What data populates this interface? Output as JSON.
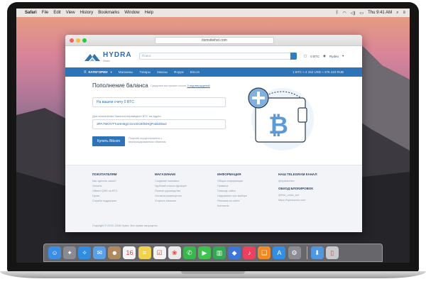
{
  "menubar": {
    "app": "Safari",
    "items": [
      "File",
      "Edit",
      "View",
      "History",
      "Bookmarks",
      "Window",
      "Help"
    ],
    "clock": "Thu 9:41 AM"
  },
  "browser": {
    "url": "itsmsiteihst.com"
  },
  "site": {
    "logo_name": "HYDRA",
    "logo_sub": "Store",
    "search_placeholder": "Поиск",
    "header_right": [
      "0 BTC",
      "Rydeo"
    ],
    "nav_category": "КАТЕГОРИИ",
    "nav_items": [
      "Магазины",
      "Товары",
      "Заказы",
      "Форум",
      "Bitcoin"
    ],
    "nav_rate": "1 BTC ≈ 4 152 USD ≈ 276 410 RUB"
  },
  "balance": {
    "title": "Пополнение баланса",
    "note_prefix": "Средства поступают после",
    "note_link": "3 подтверждений",
    "account_field": "На вашем счету 0 BTC",
    "address_label": "Для пополнения баланса переведите BTC на адрес:",
    "address": "3PA76ЮVTТaHН8gCGm3X3Kf8HQРa5kDbк2",
    "buy_button": "Купить Bitcoin",
    "buy_note": "Покупай осуществляется с верифицированным обменом"
  },
  "footer": {
    "columns": [
      {
        "title": "ПОКУПАТЕЛЯМ",
        "links": [
          "Как сделать заказ?",
          "Оплата",
          "Обмен QIWI на BTC",
          "Hydra",
          "Служба поддержки"
        ]
      },
      {
        "title": "МАГАЗИНАМ",
        "links": [
          "Создание магазина",
          "Удобный список функций",
          "Полное руководство",
          "Условия размещения",
          "Открыть магазин"
        ]
      },
      {
        "title": "ИНФОРМАЦИЯ",
        "links": [
          "Общая информация",
          "Правила",
          "Помощь сайта",
          "Нарушение при выборе",
          "Реклама на сайте",
          "Контакты"
        ]
      },
      {
        "title": "НАШ TELEGRAM КАНАЛ",
        "links": [
          "@hydraonion"
        ]
      },
      {
        "title": "ОБХОД БЛОКИРОВОК",
        "links": [
          "@Fee_onion_bot",
          "https://hydraonion.com"
        ]
      }
    ],
    "copyright": "Copyright © 2015–2018 Hydra. Все права защищены."
  },
  "dock": {
    "icons": [
      {
        "name": "finder-icon",
        "glyph": "☺",
        "color": "#3a8ee6"
      },
      {
        "name": "launchpad-icon",
        "glyph": "✦",
        "color": "#8a8a92"
      },
      {
        "name": "safari-icon",
        "glyph": "✧",
        "color": "#2f8de4"
      },
      {
        "name": "mail-icon",
        "glyph": "✉",
        "color": "#5aa0e8"
      },
      {
        "name": "contacts-icon",
        "glyph": "☻",
        "color": "#b08960"
      },
      {
        "name": "calendar-icon",
        "glyph": "16",
        "color": "#f4f4f4"
      },
      {
        "name": "notes-icon",
        "glyph": "≡",
        "color": "#f2d24c"
      },
      {
        "name": "reminders-icon",
        "glyph": "☑",
        "color": "#f3f3f3"
      },
      {
        "name": "photos-icon",
        "glyph": "❀",
        "color": "#e9e9e9"
      },
      {
        "name": "messages-icon",
        "glyph": "✆",
        "color": "#37b84a"
      },
      {
        "name": "facetime-icon",
        "glyph": "▶",
        "color": "#3fc34f"
      },
      {
        "name": "numbers-icon",
        "glyph": "▥",
        "color": "#34a853"
      },
      {
        "name": "keynote-icon",
        "glyph": "◆",
        "color": "#3a77d8"
      },
      {
        "name": "itunes-icon",
        "glyph": "♪",
        "color": "#ee3f5e"
      },
      {
        "name": "ibooks-icon",
        "glyph": "❑",
        "color": "#f08a24"
      },
      {
        "name": "appstore-icon",
        "glyph": "A",
        "color": "#2f8ee6"
      },
      {
        "name": "settings-icon",
        "glyph": "⚙",
        "color": "#8c8c94"
      },
      {
        "name": "downloads-icon",
        "glyph": "⬇",
        "color": "#4f97e0"
      },
      {
        "name": "trash-icon",
        "glyph": "▯",
        "color": "#c7c9cd"
      }
    ]
  }
}
